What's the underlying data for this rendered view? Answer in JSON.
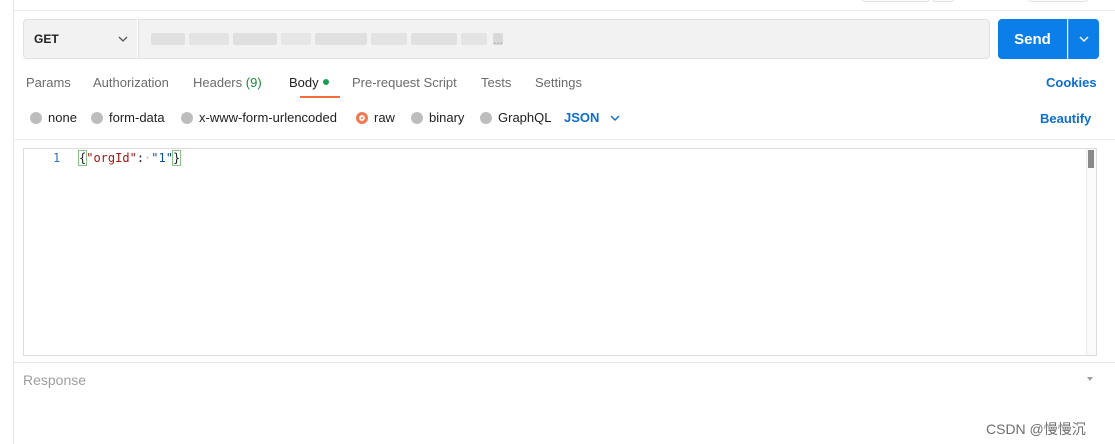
{
  "request": {
    "method": "GET",
    "url_redacted": "...",
    "send_label": "Send"
  },
  "tabs": [
    {
      "label": "Params"
    },
    {
      "label": "Authorization"
    },
    {
      "label": "Headers",
      "count": "(9)"
    },
    {
      "label": "Body"
    },
    {
      "label": "Pre-request Script"
    },
    {
      "label": "Tests"
    },
    {
      "label": "Settings"
    }
  ],
  "cookies_label": "Cookies",
  "body_types": [
    {
      "label": "none",
      "checked": false
    },
    {
      "label": "form-data",
      "checked": false
    },
    {
      "label": "x-www-form-urlencoded",
      "checked": false
    },
    {
      "label": "raw",
      "checked": true
    },
    {
      "label": "binary",
      "checked": false
    },
    {
      "label": "GraphQL",
      "checked": false
    }
  ],
  "raw_format": "JSON",
  "beautify_label": "Beautify",
  "editor": {
    "line_number": "1",
    "open_brace": "{",
    "key": "\"orgId\"",
    "colon": ":",
    "space_marker": "·",
    "value": "\"1\"",
    "close_brace": "}"
  },
  "response_label": "Response",
  "watermark": "CSDN @慢慢沉",
  "colors": {
    "accent": "#0b7ee8",
    "link": "#0b6ed1",
    "active_tab_underline": "#f26b3a",
    "body_dot": "#1aa053"
  }
}
